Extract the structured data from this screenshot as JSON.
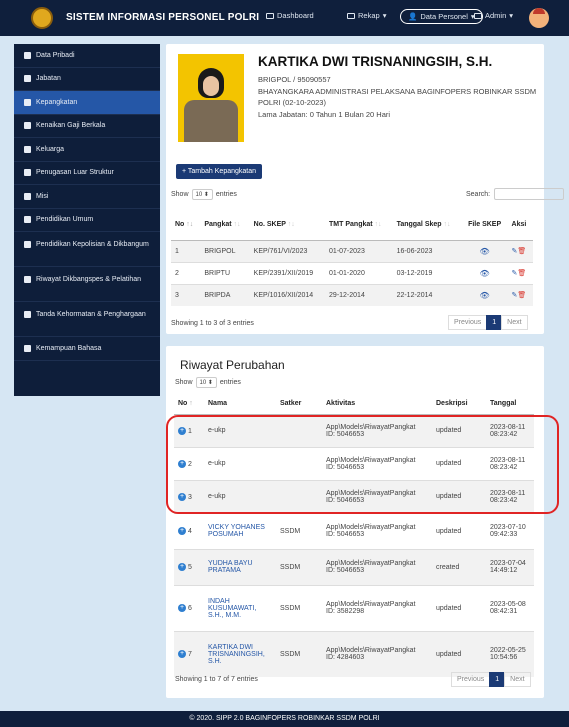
{
  "app": {
    "title": "SISTEM INFORMASI PERSONEL POLRI"
  },
  "nav": {
    "dashboard": "Dashboard",
    "rekap": "Rekap",
    "data_personel": "Data Personel",
    "admin": "Admin"
  },
  "sidebar": {
    "items": [
      {
        "label": "Data Pribadi"
      },
      {
        "label": "Jabatan"
      },
      {
        "label": "Kepangkatan"
      },
      {
        "label": "Kenaikan Gaji Berkala"
      },
      {
        "label": "Keluarga"
      },
      {
        "label": "Penugasan Luar Struktur"
      },
      {
        "label": "Misi"
      },
      {
        "label": "Pendidikan Umum"
      },
      {
        "label": "Pendidikan Kepolisian & Dikbangum"
      },
      {
        "label": "Riwayat Dikbangspes & Pelatihan"
      },
      {
        "label": "Tanda Kehormatan & Penghargaan"
      },
      {
        "label": "Kemampuan Bahasa"
      }
    ]
  },
  "profile": {
    "name": "KARTIKA DWI TRISNANINGSIH, S.H.",
    "rank_nrp": "BRIGPOL / 95090557",
    "position": "BHAYANGKARA ADMINISTRASI PELAKSANA BAGINFOPERS ROBINKAR SSDM POLRI (02-10-2023)",
    "tenure": "Lama Jabatan: 0 Tahun 1 Bulan 20 Hari"
  },
  "kepangkatan": {
    "add_button": "+ Tambah Kepangkatan",
    "show": "Show",
    "entries_value": "10",
    "entries": "entries",
    "search_label": "Search:",
    "headers": [
      "No",
      "Pangkat",
      "No. SKEP",
      "TMT Pangkat",
      "Tanggal Skep",
      "File SKEP",
      "Aksi"
    ],
    "rows": [
      {
        "no": "1",
        "pangkat": "BRIGPOL",
        "skep": "KEP/761/VI/2023",
        "tmt": "01-07-2023",
        "tgl": "16-06-2023"
      },
      {
        "no": "2",
        "pangkat": "BRIPTU",
        "skep": "KEP/2391/XII/2019",
        "tmt": "01-01-2020",
        "tgl": "03-12-2019"
      },
      {
        "no": "3",
        "pangkat": "BRIPDA",
        "skep": "KEP/1016/XII/2014",
        "tmt": "29-12-2014",
        "tgl": "22-12-2014"
      }
    ],
    "info": "Showing 1 to 3 of 3 entries",
    "prev": "Previous",
    "page": "1",
    "next": "Next"
  },
  "riwayat": {
    "title": "Riwayat Perubahan",
    "show": "Show",
    "entries_value": "10",
    "entries": "entries",
    "headers": [
      "No",
      "Nama",
      "Satker",
      "Aktivitas",
      "Deskripsi",
      "Tanggal"
    ],
    "rows": [
      {
        "no": "1",
        "nama": "e-ukp",
        "satker": "",
        "akt1": "App\\Models\\RiwayatPangkat",
        "akt2": "ID: 5046653",
        "desc": "updated",
        "tgl1": "2023-08-11",
        "tgl2": "08:23:42"
      },
      {
        "no": "2",
        "nama": "e-ukp",
        "satker": "",
        "akt1": "App\\Models\\RiwayatPangkat",
        "akt2": "ID: 5046653",
        "desc": "updated",
        "tgl1": "2023-08-11",
        "tgl2": "08:23:42"
      },
      {
        "no": "3",
        "nama": "e-ukp",
        "satker": "",
        "akt1": "App\\Models\\RiwayatPangkat",
        "akt2": "ID: 5046653",
        "desc": "updated",
        "tgl1": "2023-08-11",
        "tgl2": "08:23:42"
      },
      {
        "no": "4",
        "nama": "VICKY YOHANES POSUMAH",
        "satker": "SSDM",
        "akt1": "App\\Models\\RiwayatPangkat",
        "akt2": "ID: 5046653",
        "desc": "updated",
        "tgl1": "2023-07-10",
        "tgl2": "09:42:33"
      },
      {
        "no": "5",
        "nama": "YUDHA BAYU PRATAMA",
        "satker": "SSDM",
        "akt1": "App\\Models\\RiwayatPangkat",
        "akt2": "ID: 5046653",
        "desc": "created",
        "tgl1": "2023-07-04",
        "tgl2": "14:49:12"
      },
      {
        "no": "6",
        "nama": "INDAH KUSUMAWATI, S.H., M.M.",
        "satker": "SSDM",
        "akt1": "App\\Models\\RiwayatPangkat",
        "akt2": "ID: 3582298",
        "desc": "updated",
        "tgl1": "2023-05-08",
        "tgl2": "08:42:31"
      },
      {
        "no": "7",
        "nama": "KARTIKA DWI TRISNANINGSIH, S.H.",
        "satker": "SSDM",
        "akt1": "App\\Models\\RiwayatPangkat",
        "akt2": "ID: 4284603",
        "desc": "updated",
        "tgl1": "2022-05-25",
        "tgl2": "10:54:56"
      }
    ],
    "info": "Showing 1 to 7 of 7 entries",
    "prev": "Previous",
    "page": "1",
    "next": "Next"
  },
  "footer": {
    "text": "© 2020. SIPP 2.0 BAGINFOPERS ROBINKAR SSDM POLRI"
  },
  "colors": {
    "navy": "#0f1f3c",
    "active": "#2557a7",
    "highlight": "#e02424"
  }
}
